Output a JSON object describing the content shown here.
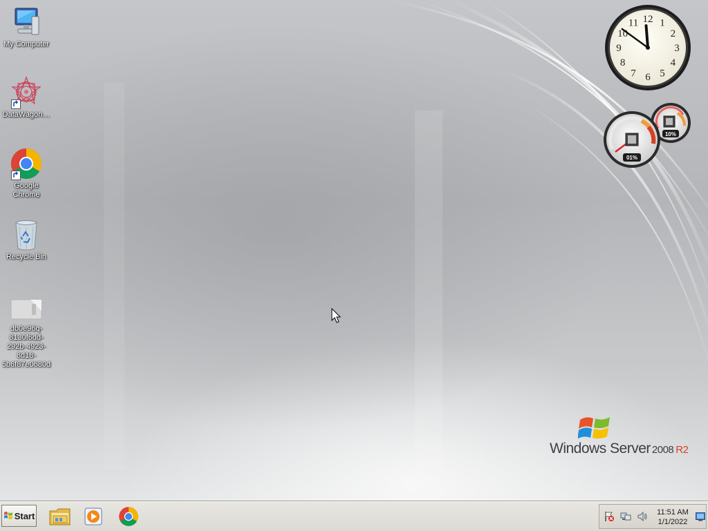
{
  "desktop": {
    "icons": [
      {
        "label": "My Computer",
        "icon": "computer-icon"
      },
      {
        "label": "DataWagon…",
        "icon": "datawagon-icon",
        "shortcut": true
      },
      {
        "label": "Google Chrome",
        "icon": "chrome-icon",
        "shortcut": true
      },
      {
        "label": "Recycle Bin",
        "icon": "recycle-bin-icon"
      },
      {
        "label": "db0e96q-8130f6dd-292b-4923-8d18-5b6f87e0680d",
        "icon": "file-icon"
      }
    ],
    "branding": {
      "product": "Windows Server",
      "year": "2008",
      "edition": "R2"
    }
  },
  "gadgets": {
    "clock": {
      "hour": 11,
      "minute": 51,
      "numerals": [
        "12",
        "1",
        "2",
        "3",
        "4",
        "5",
        "6",
        "7",
        "8",
        "9",
        "10",
        "11"
      ]
    },
    "cpu_meter": {
      "cpu": "01%",
      "memory": "10%"
    }
  },
  "taskbar": {
    "start_label": "Start",
    "pinned": [
      {
        "name": "windows-explorer",
        "icon": "folder-icon"
      },
      {
        "name": "media-player",
        "icon": "media-player-icon"
      },
      {
        "name": "google-chrome",
        "icon": "chrome-icon"
      }
    ],
    "tray": {
      "icons": [
        "action-center-flag-icon",
        "network-icon",
        "volume-icon"
      ],
      "time": "11:51 AM",
      "date": "1/1/2022"
    }
  },
  "colors": {
    "brand_r2": "#d0452a",
    "taskbar": "#dcdad3"
  }
}
